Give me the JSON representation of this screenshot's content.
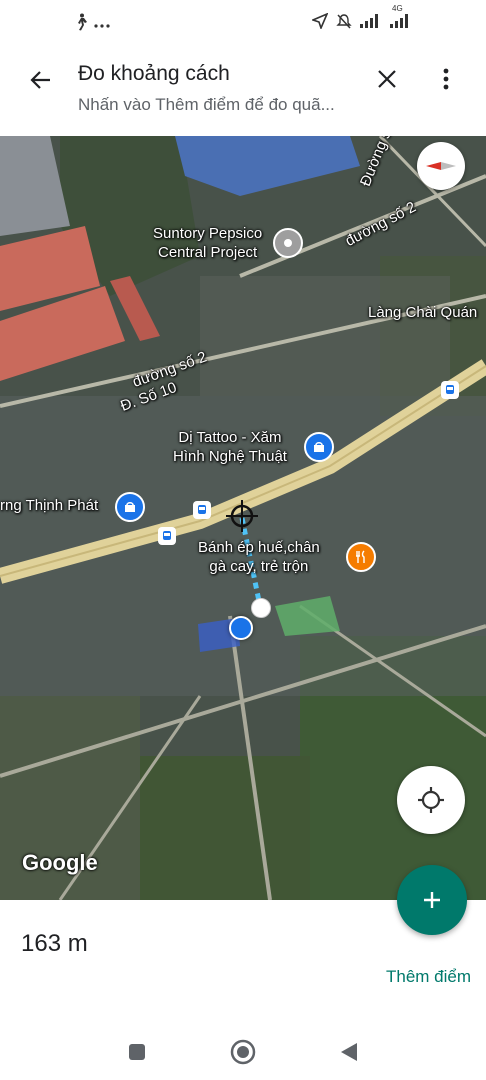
{
  "status_bar": {
    "left_icons": [
      "walking-icon",
      "more-dots-icon"
    ],
    "right_icons": [
      "location-arrow-icon",
      "mute-icon",
      "signal-icon",
      "signal-4g-icon"
    ],
    "network_label": "4G"
  },
  "header": {
    "title": "Đo khoảng cách",
    "subtitle": "Nhấn vào Thêm điểm để đo quã..."
  },
  "map": {
    "labels": {
      "suntory": "Suntory Pepsico\nCentral Project",
      "duong_so_7": "Đường số 7",
      "duong_so_2_top": "đường số 2",
      "lang_chai": "Làng Chài Quán",
      "duong_so_2_left": "đường số 2",
      "d_so_10": "Đ. Số 10",
      "tattoo": "Dị Tattoo - Xăm\nHình Nghệ Thuật",
      "thinh_phat": "rng Thịnh Phát",
      "banh_ep": "Bánh ép huế,chân\ngà cay, trẻ trộn"
    },
    "logo": "Google"
  },
  "measurement": {
    "distance": "163 m",
    "add_point_label": "Thêm điểm"
  },
  "colors": {
    "accent": "#00796b",
    "current_location": "#1a73e8",
    "poi_shop": "#1a73e8",
    "poi_food": "#f57c00",
    "road_main": "#e0d29a"
  }
}
